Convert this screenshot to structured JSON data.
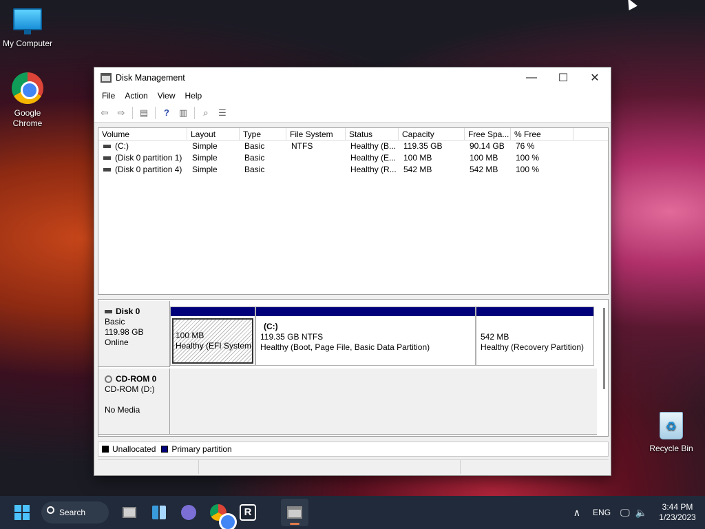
{
  "desktop": {
    "icons": [
      {
        "label": "My Computer",
        "icon": "computer-icon"
      },
      {
        "label": "Google Chrome",
        "icon": "chrome-icon"
      },
      {
        "label": "Recycle Bin",
        "icon": "recycle-bin-icon"
      }
    ]
  },
  "window": {
    "title": "Disk Management",
    "controls": {
      "minimize": "—",
      "maximize": "☐",
      "close": "✕"
    },
    "menu": [
      "File",
      "Action",
      "View",
      "Help"
    ],
    "toolbar_icons": [
      "back-icon",
      "forward-icon",
      "properties-icon",
      "help-icon",
      "show-hide-icon",
      "connect-icon",
      "list-icon"
    ]
  },
  "volume_list": {
    "columns": [
      "Volume",
      "Layout",
      "Type",
      "File System",
      "Status",
      "Capacity",
      "Free Spa...",
      "% Free"
    ],
    "rows": [
      [
        "(C:)",
        "Simple",
        "Basic",
        "NTFS",
        "Healthy (B...",
        "119.35 GB",
        "90.14 GB",
        "76 %"
      ],
      [
        "(Disk 0 partition 1)",
        "Simple",
        "Basic",
        "",
        "Healthy (E...",
        "100 MB",
        "100 MB",
        "100 %"
      ],
      [
        "(Disk 0 partition 4)",
        "Simple",
        "Basic",
        "",
        "Healthy (R...",
        "542 MB",
        "542 MB",
        "100 %"
      ]
    ]
  },
  "disks": {
    "disk0": {
      "name": "Disk 0",
      "type": "Basic",
      "size": "119.98 GB",
      "status": "Online",
      "partitions": [
        {
          "line1": "100 MB",
          "line2": "Healthy (EFI System Partition)"
        },
        {
          "label": "(C:)",
          "line1": "119.35 GB NTFS",
          "line2": "Healthy (Boot, Page File, Basic Data Partition)"
        },
        {
          "line1": "542 MB",
          "line2": "Healthy (Recovery Partition)"
        }
      ]
    },
    "cdrom0": {
      "name": "CD-ROM 0",
      "drive": "CD-ROM (D:)",
      "media": "No Media"
    }
  },
  "legend": {
    "unallocated": "Unallocated",
    "primary": "Primary partition",
    "colors": {
      "unallocated": "#000000",
      "primary": "#00007a"
    }
  },
  "taskbar": {
    "search_label": "Search",
    "language": "ENG",
    "time": "3:44 PM",
    "date": "1/23/2023"
  }
}
